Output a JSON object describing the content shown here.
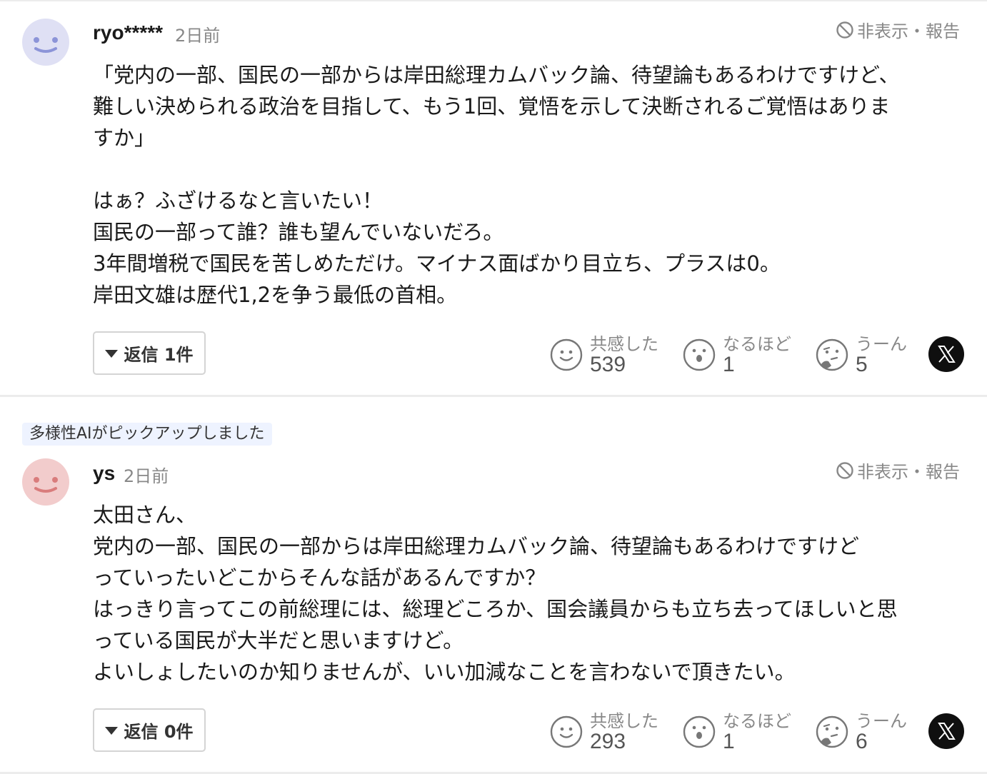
{
  "comments": [
    {
      "username": "ryo*****",
      "date": "2日前",
      "hide_report": "非表示・報告",
      "avatar_color": "#dfe0f4",
      "avatar_face_color": "#8c94d8",
      "body": [
        "「党内の一部、国民の一部からは岸田総理カムバック論、待望論もあるわけですけど、",
        "難しい決められる政治を目指して、もう1回、覚悟を示して決断されるご覚悟はありま",
        "すか」",
        "",
        "はぁ？ふざけるなと言いたい！",
        "国民の一部って誰？誰も望んでいないだろ。",
        "3年間増税で国民を苦しめただけ。マイナス面ばかり目立ち、プラスは0。",
        "岸田文雄は歴代1,2を争う最低の首相。"
      ],
      "reply_label": "返信 1件",
      "reactions": [
        {
          "label": "共感した",
          "count": "539",
          "icon": "smile-icon"
        },
        {
          "label": "なるほど",
          "count": "1",
          "icon": "surprised-icon"
        },
        {
          "label": "うーん",
          "count": "5",
          "icon": "thinking-icon"
        }
      ]
    },
    {
      "badge": "多様性AIがピックアップしました",
      "username": "ys",
      "date": "2日前",
      "hide_report": "非表示・報告",
      "avatar_color": "#f2cccc",
      "avatar_face_color": "#d97c7c",
      "body": [
        "太田さん、",
        "党内の一部、国民の一部からは岸田総理カムバック論、待望論もあるわけですけど",
        "っていったいどこからそんな話があるんですか？",
        "はっきり言ってこの前総理には、総理どころか、国会議員からも立ち去ってほしいと思",
        "っている国民が大半だと思いますけど。",
        "よいしょしたいのか知りませんが、いい加減なことを言わないで頂きたい。"
      ],
      "reply_label": "返信 0件",
      "reactions": [
        {
          "label": "共感した",
          "count": "293",
          "icon": "smile-icon"
        },
        {
          "label": "なるほど",
          "count": "1",
          "icon": "surprised-icon"
        },
        {
          "label": "うーん",
          "count": "6",
          "icon": "thinking-icon"
        }
      ]
    }
  ],
  "share": {
    "icon": "x-logo-icon"
  },
  "colors": {
    "text": "#1a1a1a",
    "muted": "#888888",
    "divider": "#ececec"
  }
}
